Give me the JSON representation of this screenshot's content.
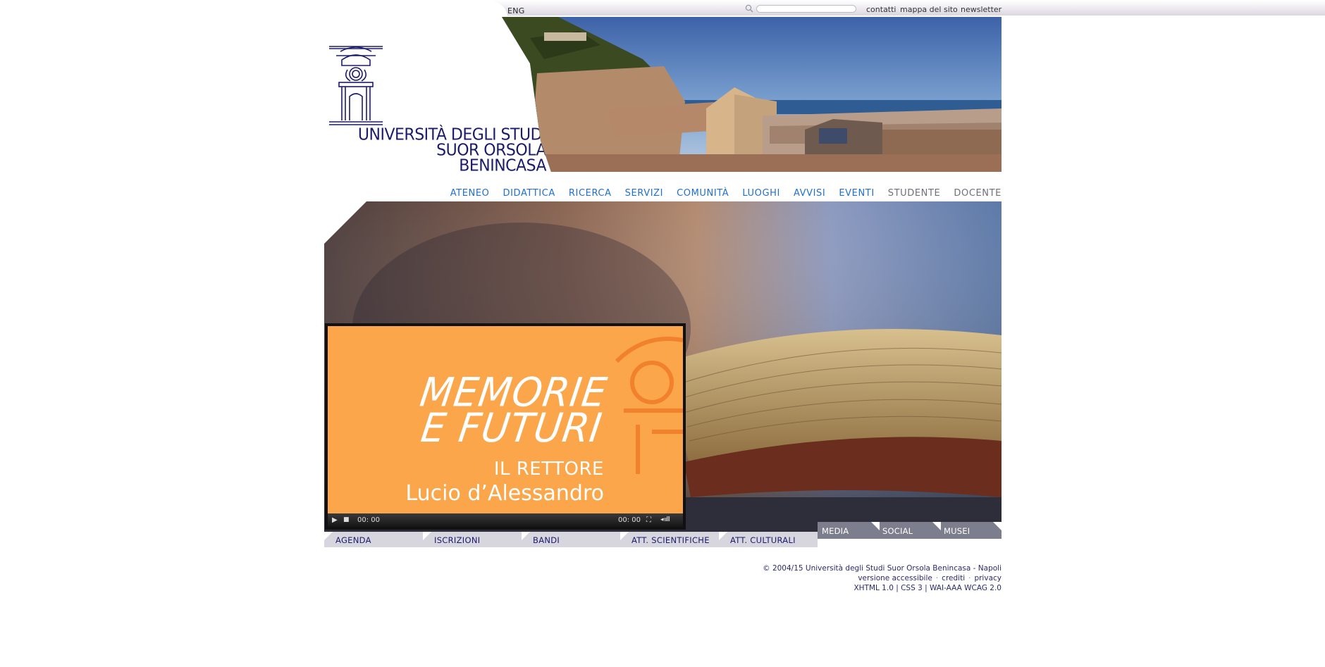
{
  "top": {
    "lang": "ENG",
    "search": {
      "value": "",
      "placeholder": ""
    },
    "links": [
      "contatti",
      "mappa del sito",
      "newsletter"
    ]
  },
  "header": {
    "uni_name": [
      "UNIVERSITÀ DEGLI STUDI",
      "SUOR ORSOLA",
      "BENINCASA"
    ]
  },
  "nav": {
    "items": [
      "ATENEO",
      "DIDATTICA",
      "RICERCA",
      "SERVIZI",
      "COMUNITÀ",
      "LUOGHI",
      "AVVISI",
      "EVENTI",
      "STUDENTE",
      "DOCENTE"
    ]
  },
  "video": {
    "title_line1": "MEMORIE",
    "title_line2": "E FUTURI",
    "subtitle": "IL RETTORE",
    "name": "Lucio d’Alessandro",
    "time_current": "00: 00",
    "time_total": "00: 00"
  },
  "tabs": [
    "AGENDA",
    "ISCRIZIONI",
    "BANDI",
    "ATT. SCIENTIFICHE",
    "ATT. CULTURALI"
  ],
  "media_tabs": [
    "MEDIA",
    "SOCIAL",
    "MUSEI"
  ],
  "footer": {
    "copyright": "© 2004/15 Università degli Studi Suor Orsola Benincasa - Napoli",
    "links": [
      "versione accessibile",
      "crediti",
      "privacy"
    ],
    "standards": "XHTML 1.0 | CSS 3 | WAI-AAA WCAG 2.0"
  },
  "colors": {
    "nav_blue": "#1f6fd1",
    "nav_gray": "#6f6f7a",
    "brand_navy": "#1b1b6b",
    "video_orange": "#fba64a",
    "tab_gray": "#d7d5dd",
    "media_tab_gray": "#7c7d8d"
  }
}
